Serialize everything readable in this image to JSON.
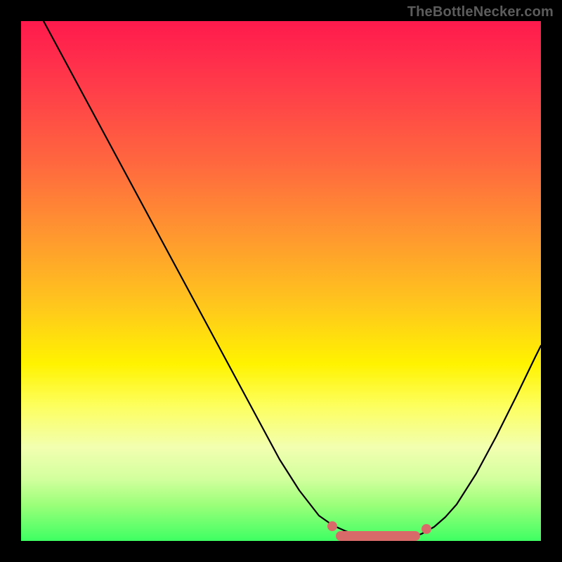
{
  "watermark": "TheBottleNecker.com",
  "chart_data": {
    "type": "line",
    "title": "",
    "xlabel": "",
    "ylabel": "",
    "xlim": [
      0,
      100
    ],
    "ylim": [
      0,
      100
    ],
    "x": [
      0,
      4,
      8,
      12,
      16,
      20,
      24,
      28,
      32,
      36,
      40,
      44,
      48,
      52,
      56,
      60,
      62,
      64,
      66,
      68,
      70,
      72,
      74,
      76,
      78,
      80,
      82,
      84,
      88,
      92,
      96,
      100
    ],
    "values": [
      null,
      100,
      93,
      86,
      79,
      72,
      65,
      58,
      51,
      44,
      37,
      30,
      23,
      16,
      10,
      5,
      3,
      2,
      1,
      0,
      0,
      0,
      0,
      0,
      1,
      2,
      4,
      7,
      13,
      20,
      28,
      36
    ],
    "gradient_scale": "bottleneck (red=high, green=low)",
    "marker_band": {
      "from": 62,
      "to": 78
    },
    "notes": "V-shaped curve dipping to zero around x≈70–74; estimated from pixels, no numeric axes shown"
  },
  "colors": {
    "background": "#000000",
    "watermark": "#5c5c5c",
    "curve": "#000000",
    "marker": "#d86a6a"
  }
}
